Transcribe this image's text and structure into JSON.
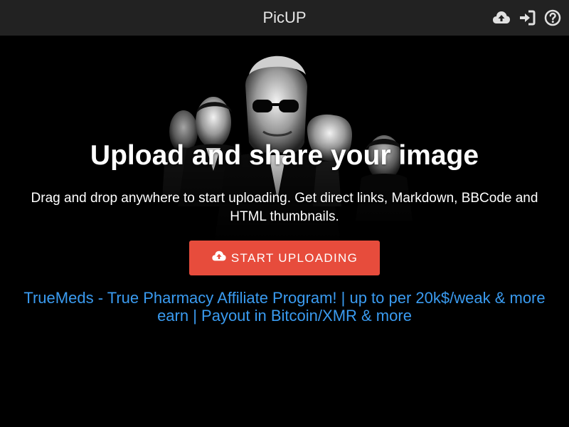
{
  "header": {
    "brand": "PicUP",
    "icons": [
      "cloud-upload-icon",
      "sign-in-icon",
      "help-icon"
    ]
  },
  "hero": {
    "headline": "Upload and share your image",
    "subline": "Drag and drop anywhere to start uploading. Get direct links, Markdown, BBCode and HTML thumbnails.",
    "button_label": "START UPLOADING",
    "ad_text": "TrueMeds - True Pharmacy Affiliate Program! | up to per 20k$/weak & more earn | Payout in Bitcoin/XMR & more"
  },
  "colors": {
    "topbar": "#222222",
    "background": "#000000",
    "accent_button": "#e74c3c",
    "link": "#3a9bf0"
  }
}
